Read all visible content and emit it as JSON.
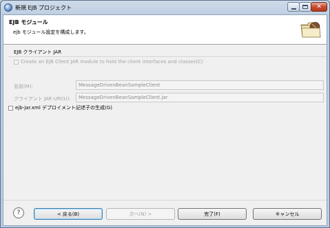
{
  "window": {
    "title": "新規 EJB プロジェクト"
  },
  "banner": {
    "title": "EJB モジュール",
    "description": "ejb モジュール設定を構成します。"
  },
  "client_jar_group": {
    "label": "EJB クライアント JAR",
    "create_checkbox_label": "Create an EJB Client JAR module to hold the client interfaces and classes(C)",
    "create_checked": false,
    "name_label": "名前(M):",
    "name_value": "MessageDrivenBeanSampleClient",
    "uri_label": "クライアント JAR URI(U):",
    "uri_value": "MessageDrivenBeanSampleClient.jar"
  },
  "deployment_descriptor": {
    "label": "ejb-jar.xml デプロイメント記述子の生成(G)",
    "checked": false
  },
  "buttons": {
    "help": "?",
    "back": "< 戻る(B)",
    "next": "次へ(N) >",
    "finish": "完了(F)",
    "cancel": "キャンセル"
  }
}
